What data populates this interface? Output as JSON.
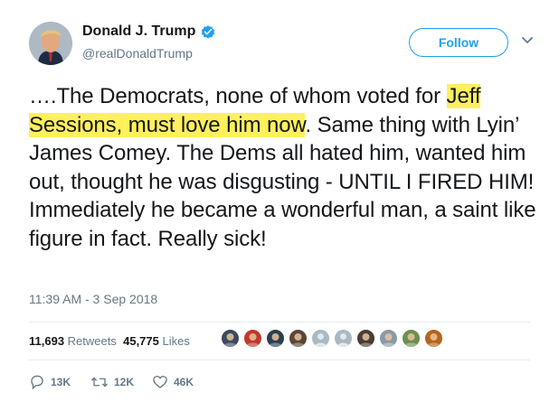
{
  "user": {
    "name": "Donald J. Trump",
    "handle": "@realDonaldTrump",
    "verified": true,
    "verified_icon": "verified-badge-icon",
    "avatar_icon": "profile-photo"
  },
  "follow_button": {
    "label": "Follow"
  },
  "menu": {
    "icon": "chevron-down-icon"
  },
  "tweet": {
    "text_before": "….The Democrats, none of whom voted for ",
    "highlighted": "Jeff Sessions, must love him now",
    "text_after": ". Same thing with Lyin’ James Comey. The Dems all hated him, wanted him out, thought he was disgusting - UNTIL I FIRED HIM! Immediately he became a wonderful man, a saint like figure in fact. Really sick!",
    "highlight_color": "#fff05c",
    "timestamp": "11:39 AM - 3 Sep 2018"
  },
  "stats": {
    "retweets_count": "11,693",
    "retweets_label": "Retweets",
    "likes_count": "45,775",
    "likes_label": "Likes"
  },
  "likers": [
    {
      "color": "#3b4a5c",
      "icon": "liker-avatar"
    },
    {
      "color": "#c0392b",
      "icon": "liker-avatar"
    },
    {
      "color": "#2c3e50",
      "icon": "liker-avatar"
    },
    {
      "color": "#5a4636",
      "icon": "liker-avatar"
    },
    {
      "color": "#aab8c2",
      "icon": "default-avatar"
    },
    {
      "color": "#aab8c2",
      "icon": "default-avatar"
    },
    {
      "color": "#4a3b33",
      "icon": "liker-avatar"
    },
    {
      "color": "#8a9aa6",
      "icon": "liker-avatar"
    },
    {
      "color": "#6d8f4e",
      "icon": "liker-avatar"
    },
    {
      "color": "#b5651d",
      "icon": "liker-avatar"
    }
  ],
  "actions": {
    "replies": {
      "icon": "reply-icon",
      "count": "13K"
    },
    "retweets": {
      "icon": "retweet-icon",
      "count": "12K"
    },
    "likes": {
      "icon": "heart-icon",
      "count": "46K"
    }
  },
  "colors": {
    "accent": "#1da1f2",
    "secondary_text": "#657786",
    "primary_text": "#14171a"
  }
}
